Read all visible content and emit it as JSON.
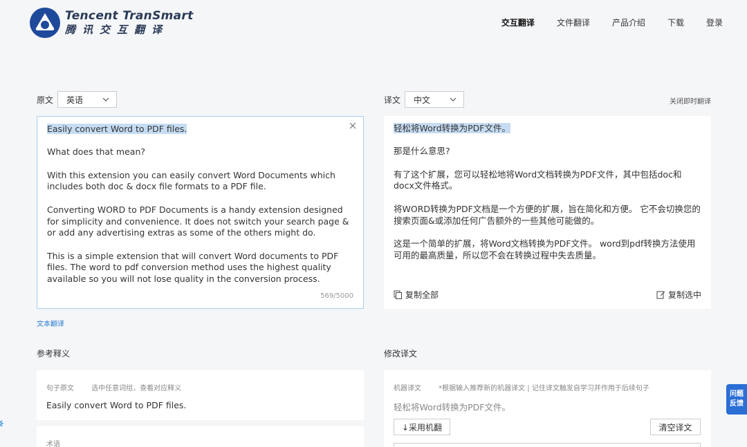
{
  "brand": {
    "name_en": "Tencent TranSmart",
    "name_cn": "腾讯交互翻译"
  },
  "nav": [
    {
      "label": "交互翻译",
      "active": true
    },
    {
      "label": "文件翻译",
      "active": false
    },
    {
      "label": "产品介绍",
      "active": false
    },
    {
      "label": "下载",
      "active": false
    },
    {
      "label": "登录",
      "active": false
    }
  ],
  "source": {
    "label": "原文",
    "language": "英语",
    "paragraphs": [
      "Easily convert Word to PDF files.",
      "What does that mean?",
      "With this extension you can easily convert Word Documents which includes both doc & docx file formats to a PDF file.",
      "Converting WORD to PDF Documents is a handy extension designed for simplicity and convenience. It does not switch your search page & or add any advertising extras as some of the others might do.",
      "This is a simple extension that will convert Word documents to PDF files. The word to pdf conversion method uses the highest quality available so you will not lose quality in the conversion process."
    ],
    "counter": "569/5000"
  },
  "target": {
    "label": "译文",
    "language": "中文",
    "close_instant": "关闭即时翻译",
    "paragraphs": [
      "轻松将Word转换为PDF文件。",
      "那是什么意思?",
      "有了这个扩展，您可以轻松地将Word文档转换为PDF文件，其中包括doc和docx文件格式。",
      "将WORD转换为PDF文档是一个方便的扩展，旨在简化和方便。 它不会切换您的搜索页面&或添加任何广告额外的一些其他可能做的。",
      "这是一个简单的扩展，将Word文档转换为PDF文件。 word到pdf转换方法使用可用的最高质量，所以您不会在转换过程中失去质量。"
    ],
    "copy_all": "复制全部",
    "copy_selected": "复制选中"
  },
  "text_translate_link": "文本翻译",
  "reference": {
    "title": "参考释义",
    "sentence_label": "句子原文",
    "sentence_hint": "选中任意词组，查看对应释义",
    "sentence": "Easily convert Word to PDF files.",
    "term_label": "术语"
  },
  "edit": {
    "title": "修改译文",
    "mt_label": "机器译文",
    "mt_hint": "*根据输入推荐新的机器译文 | 记住译文触发自学习并作用于后续句子",
    "mt_text": "轻松将Word转换为PDF文件。",
    "adopt_button": "↓采用机翻",
    "clear_button": "清空译文"
  },
  "feedback": {
    "line1": "问题",
    "line2": "反馈"
  },
  "colors": {
    "accent": "#2b6fd6",
    "highlight": "#c6dcf3",
    "border_focus": "#a9cdea"
  }
}
